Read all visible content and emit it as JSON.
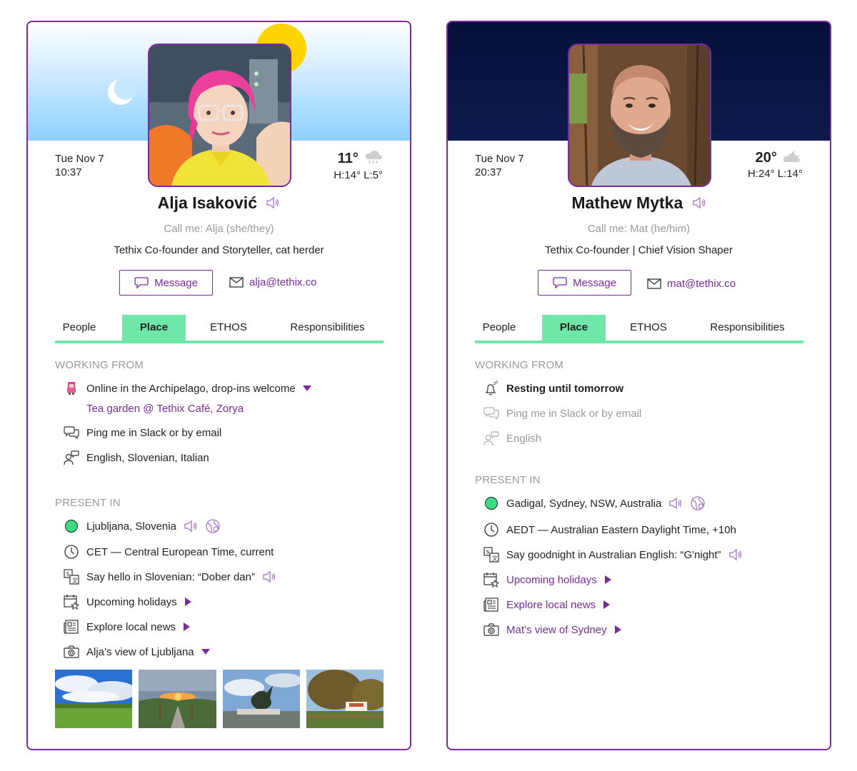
{
  "cards": [
    {
      "datetime": {
        "date": "Tue Nov 7",
        "time": "10:37"
      },
      "weather": {
        "temp": "11°",
        "hl": "H:14° L:5°",
        "icon": "rain-cloud-icon"
      },
      "name": "Alja Isaković",
      "callme": "Call me: Alja (she/they)",
      "role": "Tethix Co-founder and Storyteller, cat herder",
      "message_label": "Message",
      "email": "alja@tethix.co",
      "tabs": [
        "People",
        "Place",
        "ETHOS",
        "Responsibilities"
      ],
      "active_tab": "Place",
      "working_from": {
        "heading": "WORKING FROM",
        "location": "Online in the Archipelago, drop-ins welcome",
        "location_sub": "Tea garden @ Tethix Café, Zorya",
        "contact": "Ping me in Slack or by email",
        "languages": "English, Slovenian, Italian"
      },
      "present_in": {
        "heading": "PRESENT IN",
        "place": "Ljubljana, Slovenia",
        "timezone": "CET — Central European Time, current",
        "greeting": "Say hello in Slovenian: “Dober dan”",
        "holidays": "Upcoming holidays",
        "news": "Explore local news",
        "view": "Alja’s view of Ljubljana"
      }
    },
    {
      "datetime": {
        "date": "Tue Nov 7",
        "time": "20:37"
      },
      "weather": {
        "temp": "20°",
        "hl": "H:24° L:14°",
        "icon": "partly-cloudy-night-icon"
      },
      "name": "Mathew Mytka",
      "callme": "Call me: Mat (he/him)",
      "role": "Tethix Co-founder | Chief Vision Shaper",
      "message_label": "Message",
      "email": "mat@tethix.co",
      "tabs": [
        "People",
        "Place",
        "ETHOS",
        "Responsibilities"
      ],
      "active_tab": "Place",
      "working_from": {
        "heading": "WORKING FROM",
        "status": "Resting until tomorrow",
        "contact": "Ping me in Slack or by email",
        "languages": "English"
      },
      "present_in": {
        "heading": "PRESENT IN",
        "place": "Gadigal, Sydney, NSW, Australia",
        "timezone": "AEDT — Australian Eastern Daylight Time, +10h",
        "greeting": "Say goodnight in Australian English: “G'night”",
        "holidays": "Upcoming holidays",
        "news": "Explore local news",
        "view": "Mat’s view of Sydney"
      }
    }
  ],
  "colors": {
    "accent": "#7a2a9c",
    "tab_active": "#6ee7a8",
    "present_dot": "#3ddc84",
    "muted": "#9a9a9a"
  }
}
